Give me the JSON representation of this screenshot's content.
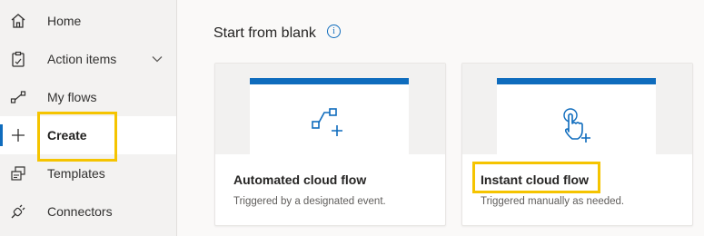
{
  "sidebar": {
    "items": [
      {
        "label": "Home",
        "icon": "home-icon"
      },
      {
        "label": "Action items",
        "icon": "clipboard-icon"
      },
      {
        "label": "My flows",
        "icon": "flow-icon"
      },
      {
        "label": "Create",
        "icon": "plus-icon"
      },
      {
        "label": "Templates",
        "icon": "templates-icon"
      },
      {
        "label": "Connectors",
        "icon": "plug-icon"
      }
    ],
    "active": "Create"
  },
  "main": {
    "section_title": "Start from blank",
    "info_glyph": "i",
    "cards": [
      {
        "title": "Automated cloud flow",
        "description": "Triggered by a designated event.",
        "icon": "automated-flow-icon"
      },
      {
        "title": "Instant cloud flow",
        "description": "Triggered manually as needed.",
        "icon": "touch-icon"
      }
    ]
  },
  "colors": {
    "accent": "#0f6cbd",
    "highlight": "#f5c400",
    "sidebar_bg": "#f3f2f1"
  }
}
